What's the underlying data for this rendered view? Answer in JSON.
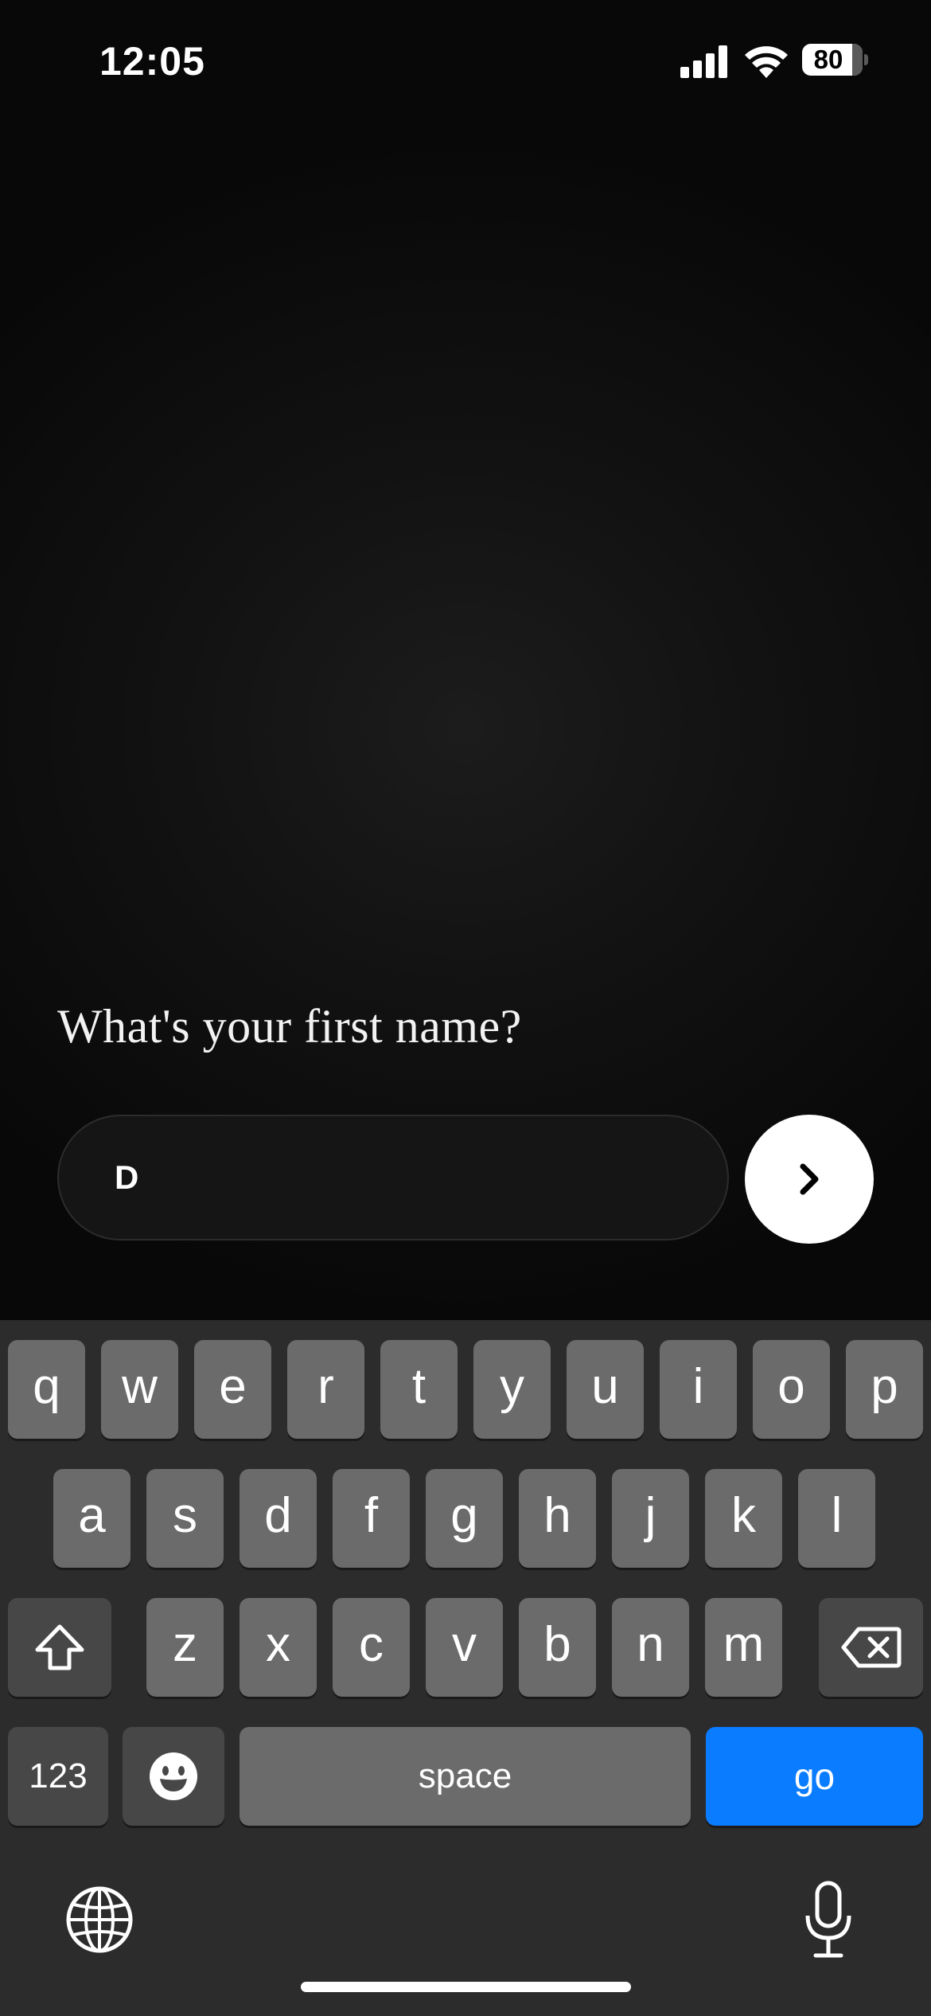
{
  "status_bar": {
    "time": "12:05",
    "battery": "80",
    "icons": [
      "cellular-signal-icon",
      "wifi-icon",
      "battery-icon"
    ]
  },
  "onboarding": {
    "question": "What's your first name?",
    "name_value": "D",
    "next_icon": "chevron-right-icon"
  },
  "keyboard": {
    "row1": [
      "q",
      "w",
      "e",
      "r",
      "t",
      "y",
      "u",
      "i",
      "o",
      "p"
    ],
    "row2": [
      "a",
      "s",
      "d",
      "f",
      "g",
      "h",
      "j",
      "k",
      "l"
    ],
    "row3": [
      "z",
      "x",
      "c",
      "v",
      "b",
      "n",
      "m"
    ],
    "numbers_label": "123",
    "space_label": "space",
    "go_label": "go",
    "icons": [
      "shift-icon",
      "delete-icon",
      "emoji-icon",
      "globe-icon",
      "microphone-icon"
    ]
  },
  "colors": {
    "go_key": "#0a7cff",
    "key": "#6b6b6b",
    "keyboard_bg": "#2c2c2c"
  }
}
